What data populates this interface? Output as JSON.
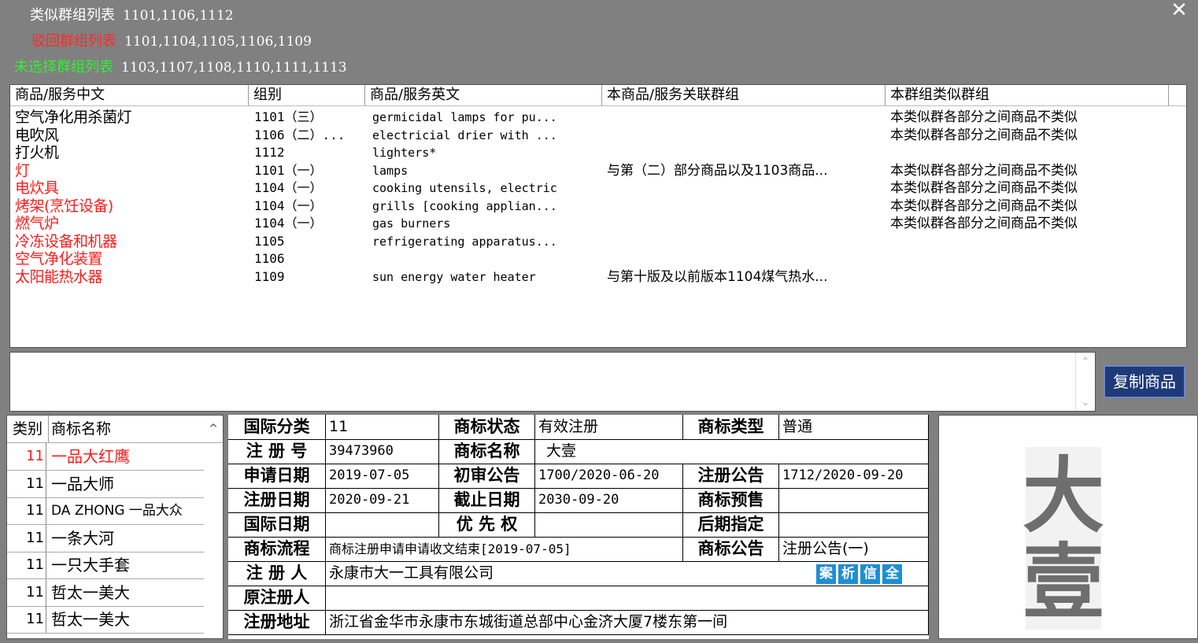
{
  "summary": {
    "similar": {
      "label": "类似群组列表",
      "value": "1101,1106,1112",
      "color": "#ffffff"
    },
    "rejected": {
      "label": "驳回群组列表",
      "value": "1101,1104,1105,1106,1109",
      "color": "#ff2a2a"
    },
    "unselected": {
      "label": "未选择群组列表",
      "value": "1103,1107,1108,1110,1111,1113",
      "color": "#33ee33"
    }
  },
  "goods": {
    "headers": [
      "商品/服务中文",
      "组别",
      "商品/服务英文",
      "本商品/服务关联群组",
      "本群组类似群组"
    ],
    "rows": [
      {
        "cn": "空气净化用杀菌灯",
        "group": "1101（三）",
        "en": "germicidal lamps for pu...",
        "rel": "",
        "sim": "本类似群各部分之间商品不类似",
        "red": false
      },
      {
        "cn": "电吹风",
        "group": "1106（二）...",
        "en": "electricial drier with ...",
        "rel": "",
        "sim": "本类似群各部分之间商品不类似",
        "red": false
      },
      {
        "cn": "打火机",
        "group": "1112",
        "en": "lighters*",
        "rel": "",
        "sim": "",
        "red": false
      },
      {
        "cn": "灯",
        "group": "1101（一）",
        "en": "lamps",
        "rel": "与第（二）部分商品以及1103商品...",
        "sim": "本类似群各部分之间商品不类似",
        "red": true
      },
      {
        "cn": "电炊具",
        "group": "1104（一）",
        "en": "cooking utensils, electric",
        "rel": "",
        "sim": "本类似群各部分之间商品不类似",
        "red": true
      },
      {
        "cn": "烤架(烹饪设备)",
        "group": "1104（一）",
        "en": "grills [cooking applian...",
        "rel": "",
        "sim": "本类似群各部分之间商品不类似",
        "red": true
      },
      {
        "cn": "燃气炉",
        "group": "1104（一）",
        "en": "gas burners",
        "rel": "",
        "sim": "本类似群各部分之间商品不类似",
        "red": true
      },
      {
        "cn": "冷冻设备和机器",
        "group": "1105",
        "en": "refrigerating apparatus...",
        "rel": "",
        "sim": "",
        "red": true
      },
      {
        "cn": "空气净化装置",
        "group": "1106",
        "en": "",
        "rel": "",
        "sim": "",
        "red": true
      },
      {
        "cn": "太阳能热水器",
        "group": "1109",
        "en": "sun energy water heater",
        "rel": "与第十版及以前版本1104煤气热水...",
        "sim": "",
        "red": true
      }
    ]
  },
  "copy_button": "复制商品",
  "close_symbol": "✕",
  "trademarks": {
    "headers": {
      "cls": "类别",
      "name": "商标名称"
    },
    "rows": [
      {
        "cls": "11",
        "name": "一品大红鹰",
        "red": true
      },
      {
        "cls": "11",
        "name": "一品大师",
        "red": false
      },
      {
        "cls": "11",
        "name": "DA ZHONG 一品大众",
        "red": false
      },
      {
        "cls": "11",
        "name": "一条大河",
        "red": false
      },
      {
        "cls": "11",
        "name": "一只大手套",
        "red": false
      },
      {
        "cls": "11",
        "name": "哲太一美大",
        "red": false
      },
      {
        "cls": "11",
        "name": "哲太一美大",
        "red": false
      }
    ]
  },
  "detail": {
    "intl_class_label": "国际分类",
    "intl_class": "11",
    "status_label": "商标状态",
    "status": "有效注册",
    "type_label": "商标类型",
    "type": "普通",
    "reg_no_label": "注 册 号",
    "reg_no": "39473960",
    "name_label": "商标名称",
    "name": "大壹",
    "apply_date_label": "申请日期",
    "apply_date": "2019-07-05",
    "prelim_label": "初审公告",
    "prelim": "1700/2020-06-20",
    "reg_pub_label": "注册公告",
    "reg_pub": "1712/2020-09-20",
    "reg_date_label": "注册日期",
    "reg_date": "2020-09-21",
    "expire_label": "截止日期",
    "expire": "2030-09-20",
    "presale_label": "商标预售",
    "presale": "",
    "intl_date_label": "国际日期",
    "intl_date": "",
    "priority_label": "优 先 权",
    "priority": "",
    "later_label": "后期指定",
    "later": "",
    "flow_label": "商标流程",
    "flow": "商标注册申请申请收文结束[2019-07-05]",
    "pub_label": "商标公告",
    "pub": "注册公告(一)",
    "registrant_label": "注 册 人",
    "registrant": "永康市大一工具有限公司",
    "action_buttons": [
      "案",
      "析",
      "信",
      "全"
    ],
    "orig_reg_label": "原注册人",
    "orig_reg": "",
    "address_label": "注册地址",
    "address": "浙江省金华市永康市东城街道总部中心金济大厦7楼东第一间"
  },
  "logo": {
    "text": "大壹",
    "color": "#6e6e6e"
  }
}
